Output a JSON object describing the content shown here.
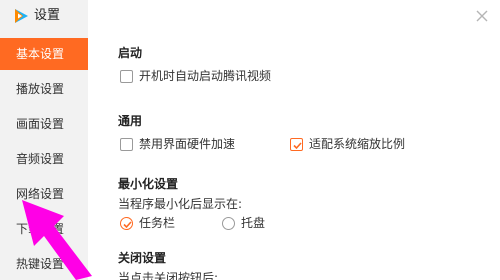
{
  "app": {
    "title": "设置",
    "accent_color": "#ff6a22",
    "logo_icon": "tencent-video-logo"
  },
  "sidebar": {
    "items": [
      {
        "label": "基本设置",
        "active": true
      },
      {
        "label": "播放设置",
        "active": false
      },
      {
        "label": "画面设置",
        "active": false
      },
      {
        "label": "音频设置",
        "active": false
      },
      {
        "label": "网络设置",
        "active": false
      },
      {
        "label": "下载设置",
        "active": false
      },
      {
        "label": "热键设置",
        "active": false
      }
    ]
  },
  "sections": {
    "startup": {
      "title": "启动",
      "options": [
        {
          "label": "开机时自动启动腾讯视频",
          "checked": false
        }
      ]
    },
    "general": {
      "title": "通用",
      "options": [
        {
          "label": "禁用界面硬件加速",
          "checked": false
        },
        {
          "label": "适配系统缩放比例",
          "checked": true
        }
      ]
    },
    "minimize": {
      "title": "最小化设置",
      "hint": "当程序最小化后显示在:",
      "options": [
        {
          "label": "任务栏",
          "selected": true
        },
        {
          "label": "托盘",
          "selected": false
        }
      ]
    },
    "close": {
      "title": "关闭设置",
      "hint": "当点击关闭按钮后:"
    }
  },
  "close_icon": "close-icon"
}
